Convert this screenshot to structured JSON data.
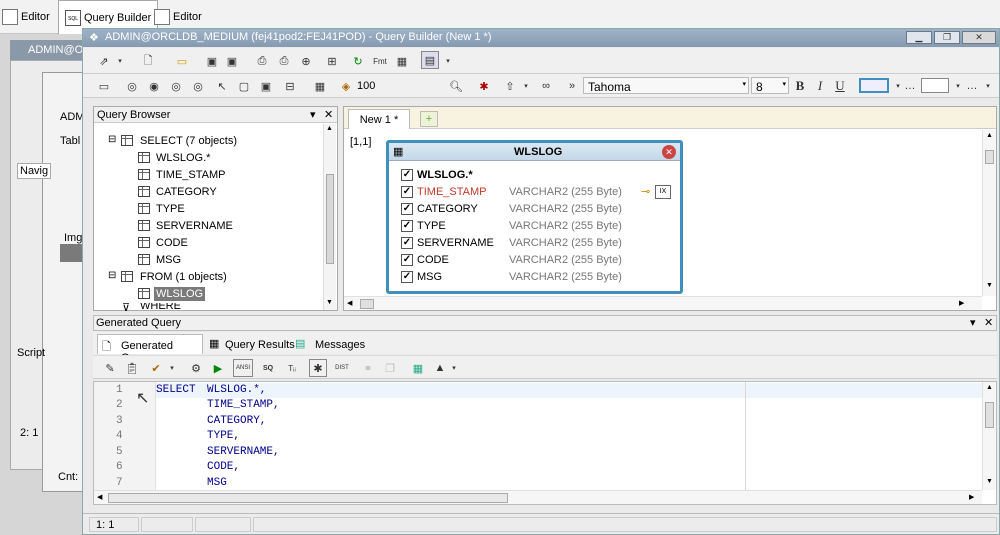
{
  "top_tabs": [
    "Editor",
    "Query Builder",
    "Editor"
  ],
  "bg_window": {
    "title": "ADMIN@O",
    "label_adm": "ADM",
    "label_tabl": "Tabl",
    "label_navig": "Navig",
    "label_img": "Img",
    "label_script": "Script",
    "status": "2:  1",
    "cnt": "Cnt:"
  },
  "window": {
    "title": "ADMIN@ORCLDB_MEDIUM (fej41pod2:FEJ41POD) - Query Builder (New 1 *)"
  },
  "toolbar2": {
    "zoom": "100",
    "font": "Tahoma",
    "font_size": "8",
    "bold": "B",
    "italic": "I",
    "underline": "U"
  },
  "query_browser": {
    "title": "Query Browser",
    "items": [
      {
        "label": "SELECT   (7 objects)"
      },
      {
        "label": "WLSLOG.*"
      },
      {
        "label": "TIME_STAMP"
      },
      {
        "label": "CATEGORY"
      },
      {
        "label": "TYPE"
      },
      {
        "label": "SERVERNAME"
      },
      {
        "label": "CODE"
      },
      {
        "label": "MSG"
      },
      {
        "label": "FROM   (1 objects)"
      },
      {
        "label": "WLSLOG"
      },
      {
        "label": "WHERE"
      }
    ]
  },
  "designer": {
    "tab": "New 1 *",
    "coord": "[1,1]",
    "table": {
      "name": "WLSLOG",
      "all_columns": "WLSLOG.*",
      "columns": [
        {
          "name": "TIME_STAMP",
          "type": "VARCHAR2 (255 Byte)"
        },
        {
          "name": "CATEGORY",
          "type": "VARCHAR2 (255 Byte)"
        },
        {
          "name": "TYPE",
          "type": "VARCHAR2 (255 Byte)"
        },
        {
          "name": "SERVERNAME",
          "type": "VARCHAR2 (255 Byte)"
        },
        {
          "name": "CODE",
          "type": "VARCHAR2 (255 Byte)"
        },
        {
          "name": "MSG",
          "type": "VARCHAR2 (255 Byte)"
        }
      ]
    }
  },
  "generated": {
    "title": "Generated Query",
    "tabs": [
      "Generated Query",
      "Query Results",
      "Messages"
    ],
    "toolbar": {
      "ansi": "ANSI",
      "sq": "SQ",
      "tq": "Tᵢᵢ",
      "dist": "DIST"
    },
    "lines": [
      {
        "num": "1",
        "kw": "SELECT",
        "text": "WLSLOG.*,"
      },
      {
        "num": "2",
        "kw": "",
        "text": "TIME_STAMP,"
      },
      {
        "num": "3",
        "kw": "",
        "text": "CATEGORY,"
      },
      {
        "num": "4",
        "kw": "",
        "text": "TYPE,"
      },
      {
        "num": "5",
        "kw": "",
        "text": "SERVERNAME,"
      },
      {
        "num": "6",
        "kw": "",
        "text": "CODE,"
      },
      {
        "num": "7",
        "kw": "",
        "text": "MSG"
      }
    ]
  },
  "status": {
    "position": "1:  1"
  }
}
